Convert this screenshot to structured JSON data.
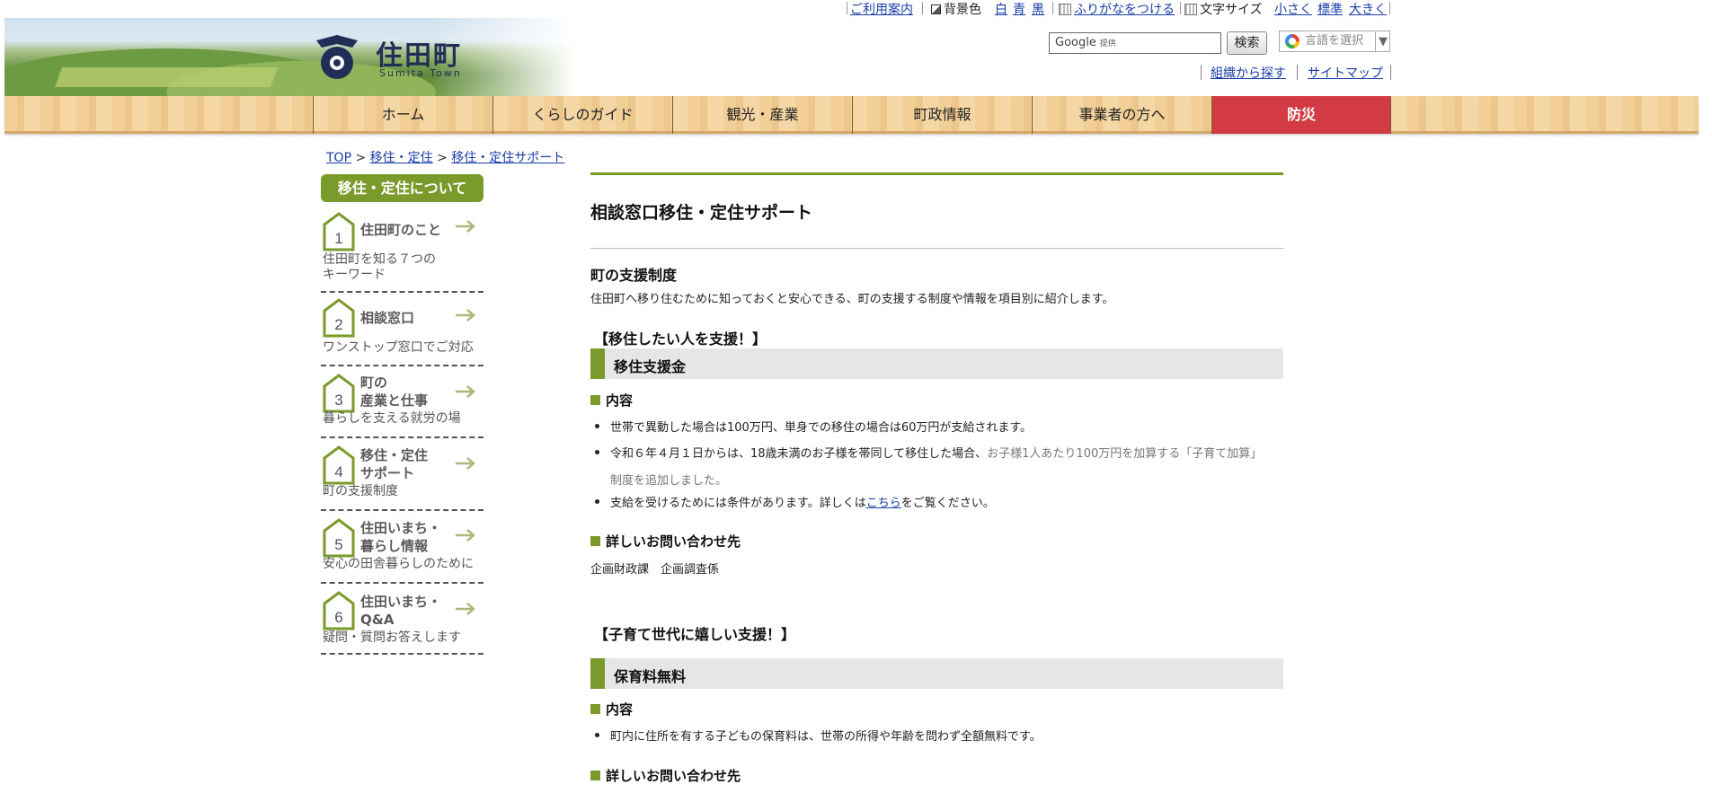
{
  "util": {
    "guide": "ご利用案内",
    "bgcolor_label": "背景色",
    "bg_white": "白",
    "bg_blue": "青",
    "bg_black": "黒",
    "furigana": "ふりがなをつける",
    "fontsize_label": "文字サイズ",
    "size_small": "小さく",
    "size_normal": "標準",
    "size_large": "大きく"
  },
  "header": {
    "logo_name": "住田町",
    "logo_roman": "Sumita Town",
    "search_placeholder": "Google",
    "search_by": "提供",
    "search_button": "検索",
    "lang_select": "言語を選択",
    "lang_arrow": "▼",
    "link_org": "組織から探す",
    "link_sitemap": "サイトマップ"
  },
  "nav": {
    "items": [
      "ホーム",
      "くらしのガイド",
      "観光・産業",
      "町政情報",
      "事業者の方へ",
      "防災"
    ]
  },
  "breadcrumb": {
    "top": "TOP",
    "sep": ">",
    "level1": "移住・定住",
    "level2": "移住・定住サポート"
  },
  "sidebar": {
    "heading": "移住・定住について",
    "items": [
      {
        "num": "1",
        "title": "住田町のこと",
        "desc": "住田町を知る７つの\nキーワード"
      },
      {
        "num": "2",
        "title": "相談窓口",
        "desc": "ワンストップ窓口でご対応"
      },
      {
        "num": "3",
        "title": "町の\n産業と仕事",
        "desc": "暮らしを支える就労の場"
      },
      {
        "num": "4",
        "title": "移住・定住\nサポート",
        "desc": "町の支援制度"
      },
      {
        "num": "5",
        "title": "住田いまち・\n暮らし情報",
        "desc": "安心の田舎暮らしのために"
      },
      {
        "num": "6",
        "title": "住田いまち・\nQ&A",
        "desc": "疑問・質問お答えします"
      }
    ]
  },
  "main": {
    "title": "相談窓口移住・定住サポート",
    "support_heading": "町の支援制度",
    "support_intro": "住田町へ移り住むために知っておくと安心できる、町の支援する制度や情報を項目別に紹介します。",
    "section1_bracket": "【移住したい人を支援！】",
    "section1_bar": "移住支援金",
    "contents_label": "内容",
    "bullet1": "世帯で異動した場合は100万円、単身での移住の場合は60万円が支給されます。",
    "bullet2_a": "令和６年４月１日からは、18歳未満のお子様を帯同して移住した場合、",
    "bullet2_b": "お子様1人あたり100万円を加算する「子育て加算」",
    "bullet2_c": "制度を追加しました。",
    "bullet3_a": "支給を受けるためには条件があります。詳しくは",
    "bullet3_link": "こちら",
    "bullet3_b": "をご覧ください。",
    "contact_label": "詳しいお問い合わせ先",
    "contact_dept": "企画財政課　企画調査係",
    "section2_bracket": "【子育て世代に嬉しい支援！】",
    "section2_bar": "保育料無料",
    "contents_label2": "内容",
    "bullet4": "町内に住所を有する子どもの保育料は、世帯の所得や年齢を問わず全額無料です。",
    "contact_label2": "詳しいお問い合わせ先"
  },
  "colors": {
    "accent_green": "#7b9a2c",
    "alert_red": "#d33b44",
    "link_blue": "#1a3ea8"
  }
}
